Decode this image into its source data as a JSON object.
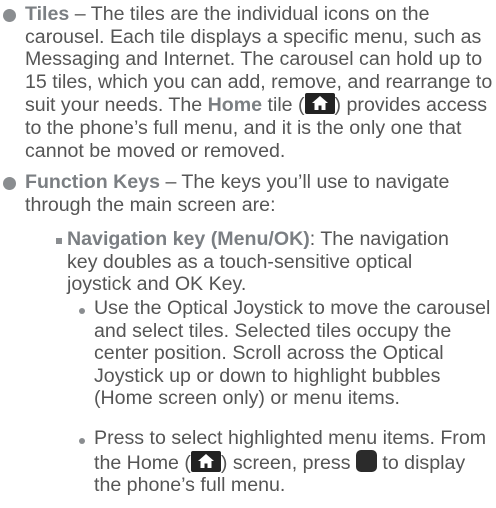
{
  "tiles_bullet": {
    "term": "Tiles",
    "text_1": " – The tiles are the individual icons on the carousel. Each tile displays a specific menu, such as Messaging and Internet. The carousel can hold up to 15 tiles, which you can add, remove, and rearrange to suit your needs. The ",
    "home_term": "Home",
    "text_2": " tile (",
    "text_3": ") provides access to the phone’s full menu, and it is the only one that cannot be moved or removed."
  },
  "function_keys_bullet": {
    "term": "Function Keys",
    "text": " – The keys you’ll use to navigate through the main screen are:"
  },
  "nav_key_item": {
    "term": "Navigation key (Menu/OK)",
    "text": ": The navigation key doubles as a touch-sensitive optical joystick and OK Key."
  },
  "joystick_item": {
    "text": "Use the Optical Joystick to move the carousel and select tiles. Selected tiles occupy the center position. Scroll across the Optical Joystick up or down to highlight bubbles (Home screen only) or menu items."
  },
  "press_item": {
    "text_1": "Press to select highlighted menu items. From the Home (",
    "text_2": ") screen, press ",
    "text_3": " to display the phone’s full menu."
  },
  "colors": {
    "text": "#555555",
    "keyword": "#7b7f83",
    "badge": "#222222"
  },
  "icons": [
    "home-icon",
    "ok-key-icon"
  ]
}
